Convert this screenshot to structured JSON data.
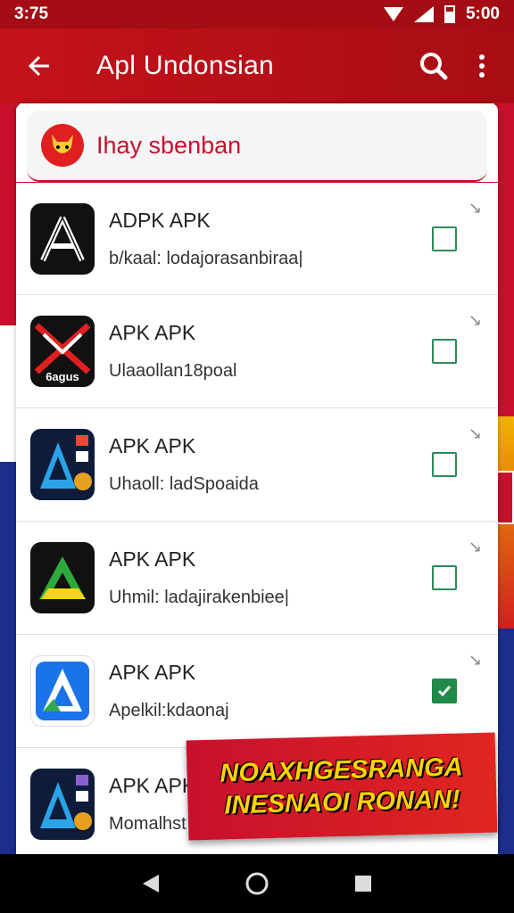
{
  "status_bar": {
    "time": "3:75",
    "clock_right": "5:00"
  },
  "app_bar": {
    "title": "Apl Undonsian"
  },
  "header_card": {
    "text": "Ihay sbenban"
  },
  "apps": [
    {
      "name": "ADPK APK",
      "subtitle": "b/kaal: lodajorasanbiraa|",
      "checked": false,
      "icon": "a-logo-black"
    },
    {
      "name": "APK APK",
      "subtitle": "Ulaaollan18poal",
      "checked": false,
      "icon": "x-logo-icon",
      "icon_caption": "6agus"
    },
    {
      "name": "APK APK",
      "subtitle": "Uhaoll: ladSpoaida",
      "checked": false,
      "icon": "a-logo-blue"
    },
    {
      "name": "APK APK",
      "subtitle": "Uhmil: ladajirakenbiee|",
      "checked": false,
      "icon": "a-logo-green"
    },
    {
      "name": "APK APK",
      "subtitle": "Apelkil:kdaonaj",
      "checked": true,
      "icon": "a-logo-google"
    },
    {
      "name": "APK APK",
      "subtitle": "Momalhst",
      "checked": false,
      "icon": "a-logo-blue"
    }
  ],
  "promo_banner": {
    "line1": "NOAXHGESRANGA",
    "line2": "INESNAOI RONAN!"
  },
  "colors": {
    "accent": "#c8102e",
    "check": "#1f8a4a"
  }
}
